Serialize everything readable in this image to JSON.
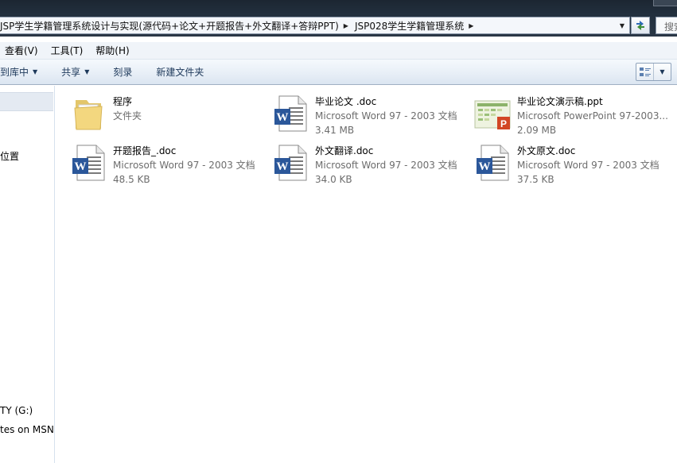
{
  "address": {
    "crumbs": [
      "JSP学生学籍管理系统设计与实现(源代码+论文+开题报告+外文翻译+答辩PPT)",
      "JSP028学生学籍管理系统"
    ],
    "search_placeholder": "搜索"
  },
  "menu": {
    "view": "查看(V)",
    "tools": "工具(T)",
    "help": "帮助(H)"
  },
  "toolbar": {
    "include_library": "到库中",
    "share": "共享",
    "burn": "刻录",
    "new_folder": "新建文件夹"
  },
  "nav": {
    "places": "位置",
    "drive": "TY (G:)",
    "msn": "tes on MSN"
  },
  "files": [
    {
      "name": "程序",
      "type": "文件夹",
      "size": "",
      "icon": "folder-icon"
    },
    {
      "name": "毕业论文 .doc",
      "type": "Microsoft Word 97 - 2003 文档",
      "size": "3.41 MB",
      "icon": "word-doc-icon"
    },
    {
      "name": "毕业论文演示稿.ppt",
      "type": "Microsoft PowerPoint 97-2003...",
      "size": "2.09 MB",
      "icon": "powerpoint-icon"
    },
    {
      "name": "开题报告_.doc",
      "type": "Microsoft Word 97 - 2003 文档",
      "size": "48.5 KB",
      "icon": "word-doc-icon"
    },
    {
      "name": "外文翻译.doc",
      "type": "Microsoft Word 97 - 2003 文档",
      "size": "34.0 KB",
      "icon": "word-doc-icon"
    },
    {
      "name": "外文原文.doc",
      "type": "Microsoft Word 97 - 2003 文档",
      "size": "37.5 KB",
      "icon": "word-doc-icon"
    }
  ]
}
